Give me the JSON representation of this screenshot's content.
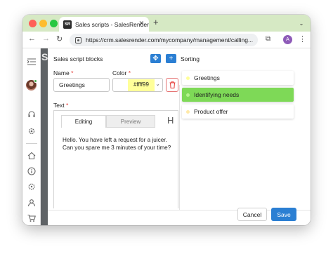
{
  "browser": {
    "tab_title": "Sales scripts - SalesRender",
    "favicon_text": "SR",
    "close_glyph": "✕",
    "new_tab_glyph": "+",
    "tab_menu_glyph": "⌄",
    "url": "https://crm.salesrender.com/mycompany/management/calling...",
    "profile_initial": "A",
    "nav": {
      "back": "←",
      "forward": "→",
      "reload": "↻",
      "menu": "⋮",
      "extensions": "⧉"
    }
  },
  "background_page": {
    "title_fragment": "S"
  },
  "modal": {
    "section_title": "Sales script blocks",
    "move_button_glyph": "✥",
    "add_button_glyph": "+",
    "sorting_title": "Sorting",
    "name_label": "Name",
    "required_mark": "*",
    "name_value": "Greetings",
    "color_label": "Color",
    "color_value": "#ffff99",
    "color_chevron": "⌄",
    "text_label": "Text",
    "editor_tabs": {
      "editing": "Editing",
      "preview": "Preview"
    },
    "heading_button": "H",
    "editor_text": "Hello. You have left a request for a juicer. Can you spare me 3 minutes of your time?",
    "sort_items": [
      {
        "label": "Greetings",
        "dot_color": "#ffff99",
        "active": false
      },
      {
        "label": "Identifying needs",
        "dot_color": "#b5f28f",
        "active": true
      },
      {
        "label": "Product offer",
        "dot_color": "#ffe9a8",
        "active": false
      }
    ],
    "cancel_label": "Cancel",
    "save_label": "Save"
  },
  "colors": {
    "accent_blue": "#2b7fd3",
    "active_green": "#7ed957",
    "delete_red": "#e53935",
    "tabbar_green": "#d6e9c4"
  }
}
